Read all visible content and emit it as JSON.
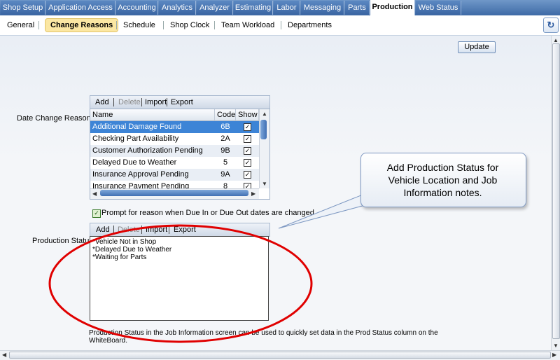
{
  "top_tabs": [
    {
      "label": "Shop Setup"
    },
    {
      "label": "Application Access"
    },
    {
      "label": "Accounting"
    },
    {
      "label": "Analytics"
    },
    {
      "label": "Analyzer"
    },
    {
      "label": "Estimating"
    },
    {
      "label": "Labor"
    },
    {
      "label": "Messaging"
    },
    {
      "label": "Parts"
    },
    {
      "label": "Production",
      "active": true
    },
    {
      "label": "Web Status"
    }
  ],
  "sub_nav": [
    {
      "label": "General"
    },
    {
      "label": "Change Reasons",
      "active": true
    },
    {
      "label": "Schedule"
    },
    {
      "label": "Shop Clock"
    },
    {
      "label": "Team Workload"
    },
    {
      "label": "Departments"
    }
  ],
  "refresh_icon": "refresh-icon",
  "update_button": "Update",
  "date_change": {
    "label": "Date Change Reasons:",
    "toolbar": {
      "add": "Add",
      "delete": "Delete",
      "import": "Import",
      "export": "Export"
    },
    "columns": [
      "Name",
      "Code",
      "Show"
    ],
    "rows": [
      {
        "name": "Additional Damage Found",
        "code": "6B",
        "show": true
      },
      {
        "name": "Checking Part Availability",
        "code": "2A",
        "show": true
      },
      {
        "name": "Customer Authorization Pending",
        "code": "9B",
        "show": true
      },
      {
        "name": "Delayed Due to Weather",
        "code": "5",
        "show": true
      },
      {
        "name": "Insurance Approval Pending",
        "code": "9A",
        "show": true
      },
      {
        "name": "Insurance Payment Pending",
        "code": "8",
        "show": true
      }
    ],
    "prompt_checkbox": {
      "checked": true,
      "label": "Prompt for reason when Due In or Due Out dates are changed."
    }
  },
  "production_status": {
    "label": "Production Status:",
    "toolbar": {
      "add": "Add",
      "delete": "Delete",
      "import": "Import",
      "export": "Export"
    },
    "lines": [
      "*Vehicle Not in Shop",
      "*Delayed Due to Weather",
      "*Waiting for Parts"
    ],
    "help_line1": "Production Status in the Job Information screen can be used to quickly set data in the Prod Status column on the",
    "help_line2": "WhiteBoard."
  },
  "callout": {
    "line1": "Add Production Status for",
    "line2": "Vehicle Location and Job",
    "line3": "Information notes."
  },
  "colors": {
    "tab_bar": "#3e6aa6",
    "active_subtab": "#fbe7a3",
    "selected_row": "#3d84d6",
    "annotation_ellipse": "#e00000"
  }
}
